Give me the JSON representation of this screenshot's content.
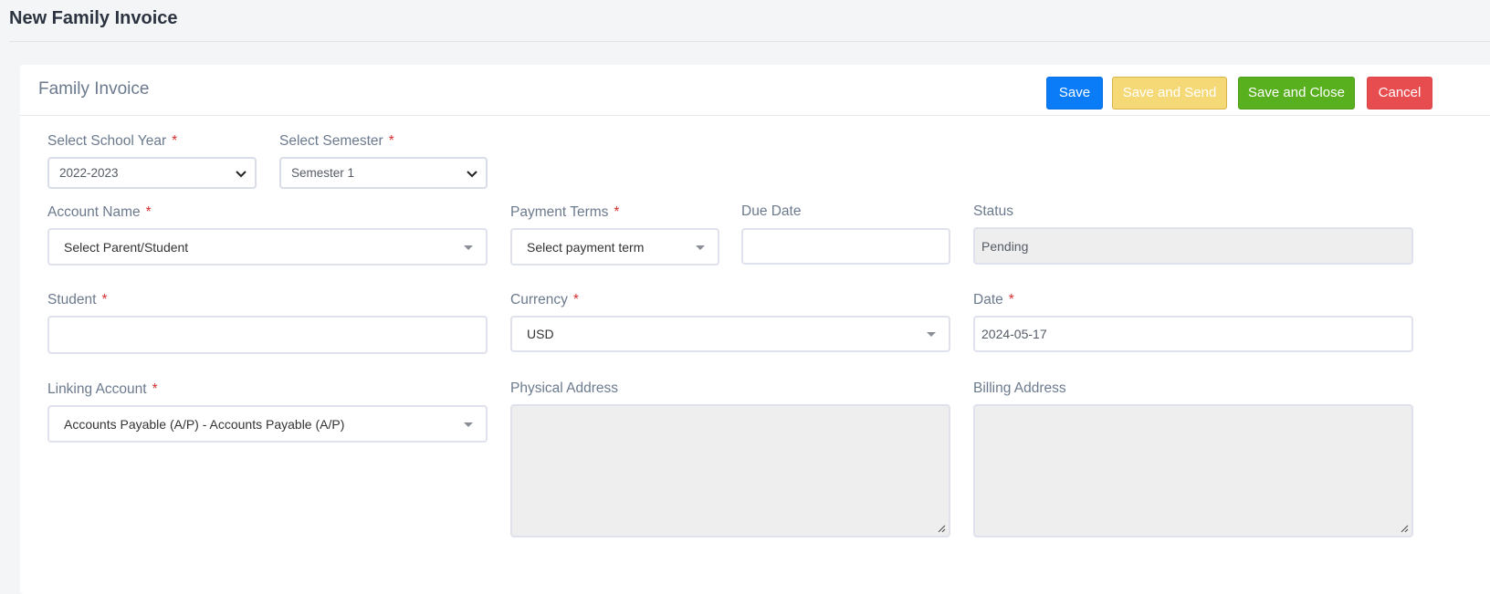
{
  "page": {
    "title": "New Family Invoice"
  },
  "card": {
    "title": "Family Invoice",
    "buttons": {
      "save": "Save",
      "save_and_send": "Save and Send",
      "save_and_close": "Save and Close",
      "cancel": "Cancel"
    }
  },
  "form": {
    "school_year": {
      "label": "Select School Year",
      "value": "2022-2023"
    },
    "semester": {
      "label": "Select Semester",
      "value": "Semester 1"
    },
    "account_name": {
      "label": "Account Name",
      "value": "Select Parent/Student"
    },
    "payment_terms": {
      "label": "Payment Terms",
      "value": "Select payment term"
    },
    "due_date": {
      "label": "Due Date",
      "value": ""
    },
    "status": {
      "label": "Status",
      "value": "Pending"
    },
    "student": {
      "label": "Student",
      "value": ""
    },
    "currency": {
      "label": "Currency",
      "value": "USD"
    },
    "date": {
      "label": "Date",
      "value": "2024-05-17"
    },
    "linking_account": {
      "label": "Linking Account",
      "value": "Accounts Payable (A/P) - Accounts Payable (A/P)"
    },
    "physical_address": {
      "label": "Physical Address",
      "value": ""
    },
    "billing_address": {
      "label": "Billing Address",
      "value": ""
    },
    "required_marker": "*"
  },
  "colors": {
    "primary": "#0a7cf7",
    "warning": "#f6d977",
    "success": "#58b01f",
    "danger": "#e74d4f",
    "required": "#d32f2f"
  }
}
